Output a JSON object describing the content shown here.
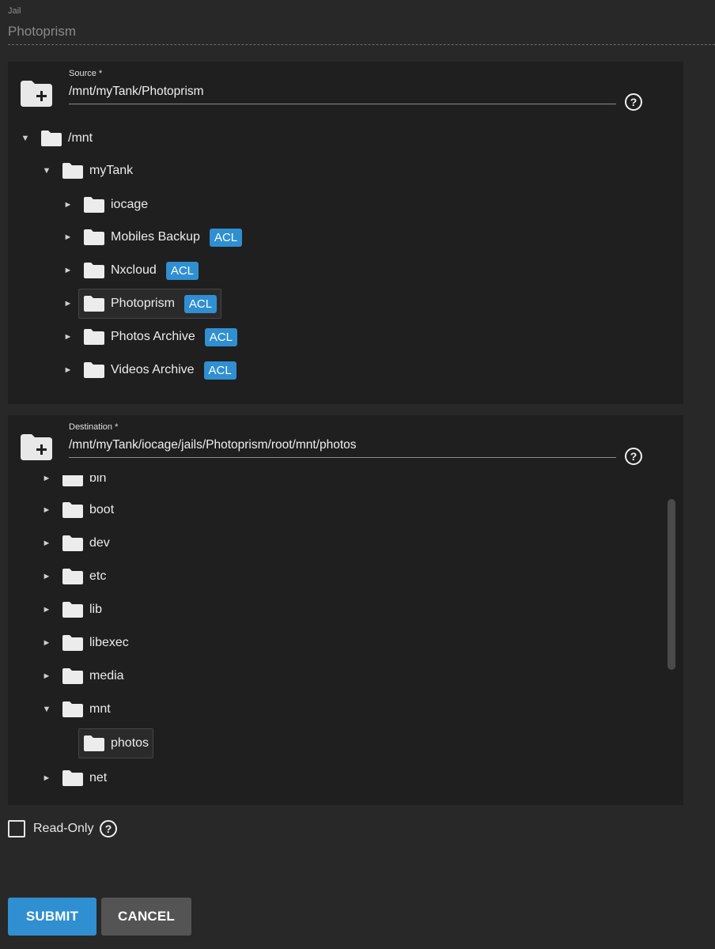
{
  "jail": {
    "label": "Jail",
    "value": "Photoprism"
  },
  "source": {
    "label": "Source *",
    "path": "/mnt/myTank/Photoprism",
    "tree": [
      {
        "name": "/mnt",
        "expanded": true,
        "acl": ""
      },
      {
        "name": "myTank",
        "expanded": true,
        "acl": ""
      },
      {
        "name": "iocage",
        "expanded": false,
        "acl": ""
      },
      {
        "name": "Mobiles Backup",
        "expanded": false,
        "acl": "ACL"
      },
      {
        "name": "Nxcloud",
        "expanded": false,
        "acl": "ACL"
      },
      {
        "name": "Photoprism",
        "expanded": false,
        "acl": "ACL",
        "selected": true
      },
      {
        "name": "Photos Archive",
        "expanded": false,
        "acl": "ACL"
      },
      {
        "name": "Videos Archive",
        "expanded": false,
        "acl": "ACL"
      }
    ]
  },
  "destination": {
    "label": "Destination *",
    "path": "/mnt/myTank/iocage/jails/Photoprism/root/mnt/photos",
    "tree": [
      {
        "name": "bin",
        "expanded": false
      },
      {
        "name": "boot",
        "expanded": false
      },
      {
        "name": "dev",
        "expanded": false
      },
      {
        "name": "etc",
        "expanded": false
      },
      {
        "name": "lib",
        "expanded": false
      },
      {
        "name": "libexec",
        "expanded": false
      },
      {
        "name": "media",
        "expanded": false
      },
      {
        "name": "mnt",
        "expanded": true
      },
      {
        "name": "photos",
        "leaf": true,
        "selected": true
      },
      {
        "name": "net",
        "expanded": false
      }
    ]
  },
  "readonly": {
    "label": "Read-Only",
    "checked": false
  },
  "buttons": {
    "submit": "SUBMIT",
    "cancel": "CANCEL"
  },
  "icons": {
    "add_folder": "create-folder-icon",
    "help": "help-circle-icon",
    "folder": "folder-icon",
    "expanded": "caret-down-icon",
    "collapsed": "caret-right-icon"
  },
  "colors": {
    "accent": "#2f8fd1",
    "background": "#282828",
    "panel": "#1f1f1f",
    "cancel": "#545454"
  }
}
